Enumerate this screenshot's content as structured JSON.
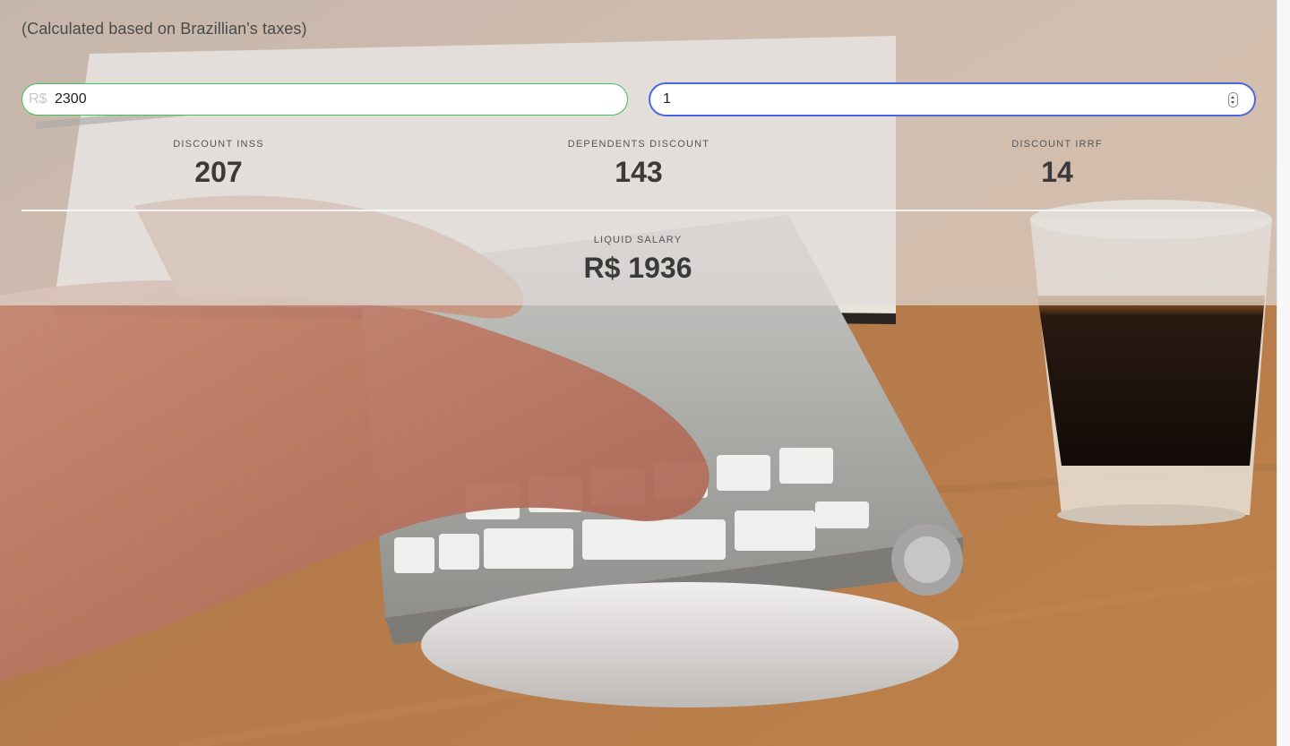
{
  "header": {
    "subtitle": "(Calculated based on Brazillian's taxes)"
  },
  "inputs": {
    "salary": {
      "prefix": "R$",
      "value": "2300"
    },
    "dependents": {
      "value": "1"
    }
  },
  "stats": {
    "inss": {
      "label": "DISCOUNT INSS",
      "value": "207"
    },
    "dependents": {
      "label": "DEPENDENTS DISCOUNT",
      "value": "143"
    },
    "irrf": {
      "label": "DISCOUNT IRRF",
      "value": "14"
    }
  },
  "result": {
    "label": "LIQUID SALARY",
    "value": "R$ 1936"
  },
  "colors": {
    "salary_border": "#3fbf5f",
    "dependents_border_focus": "#4a66e0",
    "panel_overlay": "#e0dcd8"
  },
  "icons": {
    "spinner": "number-stepper-icon"
  }
}
